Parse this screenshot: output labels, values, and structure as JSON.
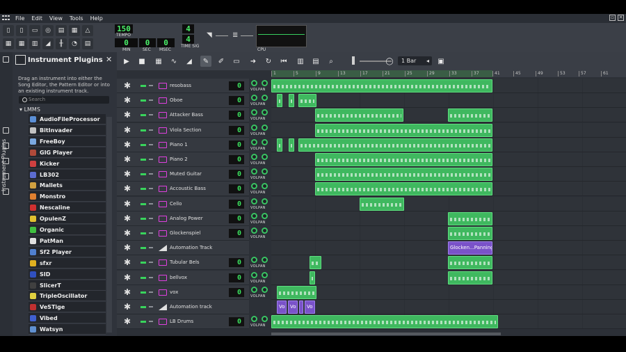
{
  "menu": [
    "File",
    "Edit",
    "View",
    "Tools",
    "Help"
  ],
  "toolbar": {
    "tempo": "150",
    "tempo_label": "TEMPO",
    "min": "0",
    "sec": "0",
    "msec": "0",
    "min_label": "MIN",
    "sec_label": "SEC",
    "msec_label": "MSEC",
    "timesig_num": "4",
    "timesig_den": "4",
    "timesig_label": "TIME SIG",
    "cpu_label": "CPU"
  },
  "side_strip_label": "Instrument Plugins",
  "plugin_panel": {
    "title": "Instrument Plugins",
    "close": "✕",
    "description": "Drag an instrument into either the Song Editor, the Pattern Editor or into an existing instrument track.",
    "search_placeholder": "Search",
    "group": "LMMS",
    "items": [
      {
        "label": "AudioFileProcessor",
        "color": "#5b8fd6"
      },
      {
        "label": "BitInvader",
        "color": "#c2c2c2"
      },
      {
        "label": "FreeBoy",
        "color": "#7aa8e0"
      },
      {
        "label": "GIG Player",
        "color": "#b04a3a"
      },
      {
        "label": "Kicker",
        "color": "#d04040"
      },
      {
        "label": "LB302",
        "color": "#5c6cd0"
      },
      {
        "label": "Mallets",
        "color": "#d0a040"
      },
      {
        "label": "Monstro",
        "color": "#e08030"
      },
      {
        "label": "Nescaline",
        "color": "#d03030"
      },
      {
        "label": "OpulenZ",
        "color": "#e0c030"
      },
      {
        "label": "Organic",
        "color": "#40c040"
      },
      {
        "label": "PatMan",
        "color": "#e0e0e0"
      },
      {
        "label": "Sf2 Player",
        "color": "#5080d0"
      },
      {
        "label": "sfxr",
        "color": "#e0b020"
      },
      {
        "label": "SID",
        "color": "#3050c0"
      },
      {
        "label": "SlicerT",
        "color": "#404040"
      },
      {
        "label": "TripleOscillator",
        "color": "#e0d040"
      },
      {
        "label": "VeSTige",
        "color": "#c03030"
      },
      {
        "label": "Vibed",
        "color": "#4060d0"
      },
      {
        "label": "Watsyn",
        "color": "#6090d0"
      }
    ]
  },
  "song_editor": {
    "bar_select": "1 Bar",
    "timeline_ticks": [
      "1",
      "5",
      "9",
      "13",
      "17",
      "21",
      "25",
      "29",
      "33",
      "37",
      "41",
      "45",
      "49",
      "53",
      "57",
      "61"
    ],
    "volpan_label": "VOLPAN",
    "tracks": [
      {
        "name": "resobass",
        "type": "instrument",
        "vu": "0"
      },
      {
        "name": "Oboe",
        "type": "instrument",
        "vu": "0"
      },
      {
        "name": "Attacker Bass",
        "type": "instrument",
        "vu": "0"
      },
      {
        "name": "Viola Section",
        "type": "instrument",
        "vu": "0"
      },
      {
        "name": "Piano 1",
        "type": "instrument",
        "vu": "0"
      },
      {
        "name": "Piano 2",
        "type": "instrument",
        "vu": "0"
      },
      {
        "name": "Muted Guitar",
        "type": "instrument",
        "vu": "0"
      },
      {
        "name": "Accoustic Bass",
        "type": "instrument",
        "vu": "0"
      },
      {
        "name": "Cello",
        "type": "instrument",
        "vu": "0"
      },
      {
        "name": "Analog Power",
        "type": "instrument",
        "vu": "0"
      },
      {
        "name": "Glockenspiel",
        "type": "instrument",
        "vu": "0"
      },
      {
        "name": "Automation Track",
        "type": "automation",
        "vu": ""
      },
      {
        "name": "Tubular Bels",
        "type": "instrument",
        "vu": "0"
      },
      {
        "name": "bellvox",
        "type": "instrument",
        "vu": "0"
      },
      {
        "name": "vox",
        "type": "instrument",
        "vu": "0"
      },
      {
        "name": "Automation track",
        "type": "automation",
        "vu": ""
      },
      {
        "name": "LB Drums",
        "type": "instrument",
        "vu": "0"
      }
    ],
    "clip_labels": {
      "glock_panning": "Glocken...Panning",
      "vo1": "Vo",
      "vo2": "Vo",
      "vo3": "Vo"
    }
  }
}
